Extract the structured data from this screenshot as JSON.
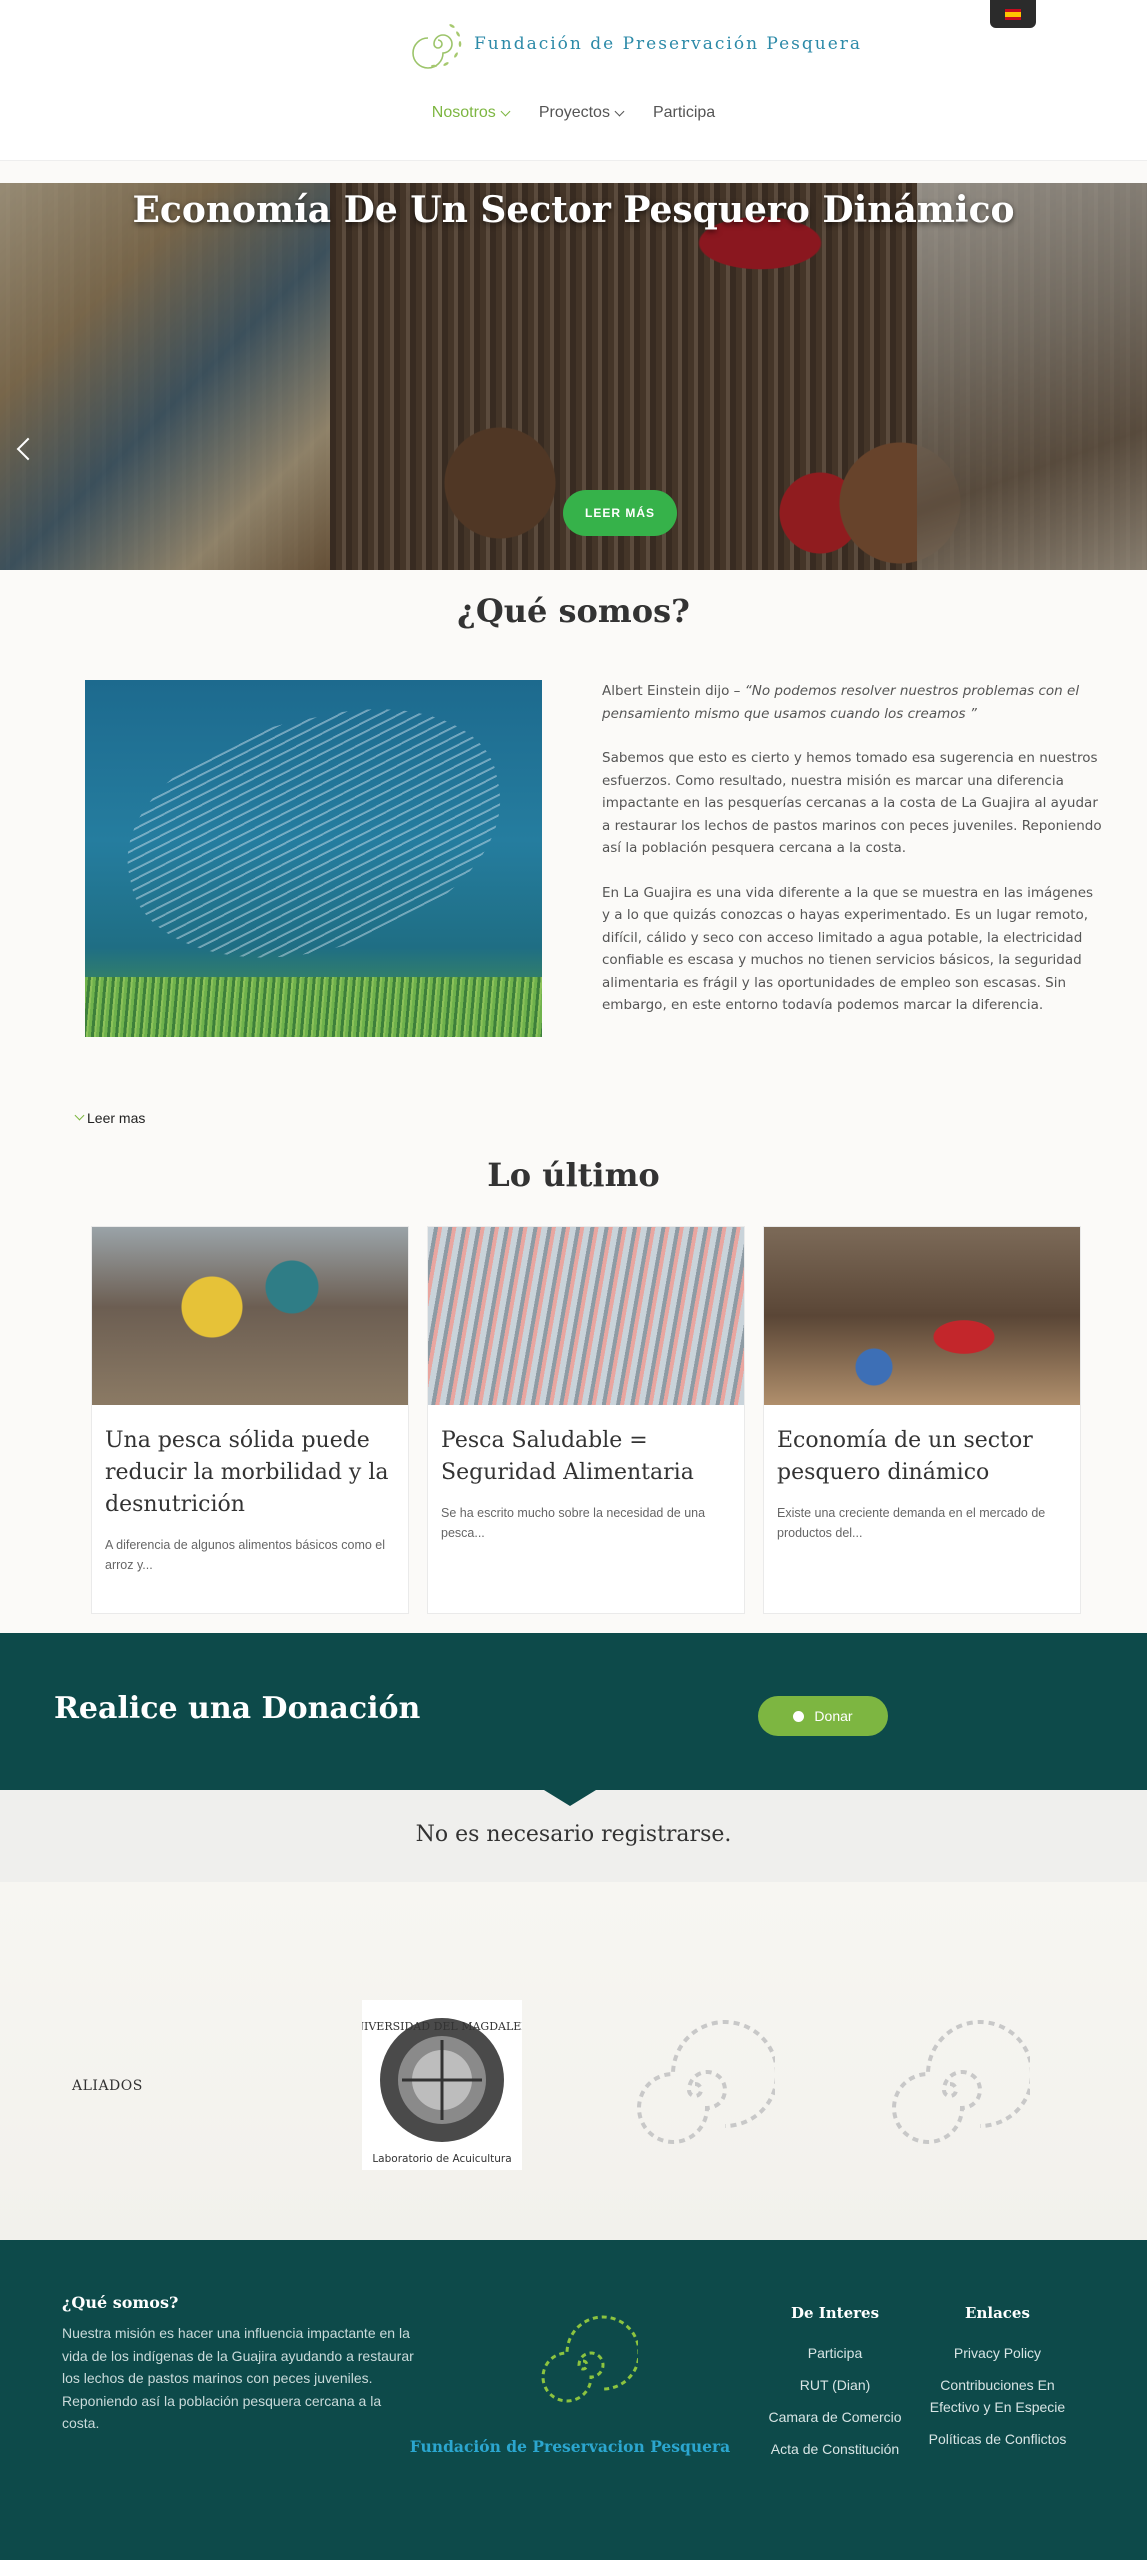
{
  "header": {
    "logo_text": "Fundación de Preservación Pesquera",
    "nav": [
      {
        "label": "Nosotros",
        "active": true
      },
      {
        "label": "Proyectos",
        "active": false
      },
      {
        "label": "Participa",
        "active": false
      }
    ]
  },
  "hero": {
    "title": "Economía De Un Sector Pesquero Dinámico",
    "button": "LEER MÁS"
  },
  "about": {
    "title": "¿Qué somos?",
    "quote_author": "Albert Einstein dijo –",
    "quote": "“No podemos resolver nuestros problemas con el pensamiento mismo que usamos cuando los creamos ”",
    "p1": "Sabemos que esto es cierto y hemos tomado esa sugerencia en nuestros esfuerzos. Como resultado, nuestra misión es marcar una diferencia impactante en las pesquerías cercanas a la costa de La Guajira al ayudar a restaurar los lechos de pastos marinos con peces juveniles. Reponiendo así la población pesquera cercana a la costa.",
    "p2": "En La Guajira es una vida diferente a la que se muestra en las imágenes y a lo que quizás conozcas o hayas experimentado. Es un lugar remoto, difícil, cálido y seco con acceso limitado a agua potable, la electricidad confiable es escasa y muchos no tienen servicios básicos, la seguridad alimentaria es frágil y las oportunidades de empleo son escasas. Sin embargo, en este entorno todavía podemos marcar la diferencia.",
    "read_more": "Leer mas"
  },
  "latest": {
    "title": "Lo último",
    "cards": [
      {
        "title": "Una pesca sólida puede reducir la morbilidad y la desnutrición",
        "excerpt": "A diferencia de algunos alimentos básicos como el arroz y..."
      },
      {
        "title": "Pesca Saludable = Seguridad Alimentaria",
        "excerpt": "Se ha escrito mucho sobre la necesidad de una pesca..."
      },
      {
        "title": "Economía de un sector pesquero dinámico",
        "excerpt": "Existe una creciente demanda en el mercado de productos del..."
      }
    ]
  },
  "donation": {
    "title": "Realice una Donación",
    "button": "Donar",
    "note": "No es necesario registrarse."
  },
  "allies": {
    "label": "ALIADOS",
    "university_name": "UNIVERSIDAD DEL MAGDALENA",
    "university_lab": "Laboratorio de Acuicultura"
  },
  "footer": {
    "about_title": "¿Qué somos?",
    "about_text": "Nuestra misión es hacer una influencia impactante en la vida de los indígenas de la Guajira ayudando a restaurar los lechos de pastos marinos con peces juveniles. Reponiendo así la población pesquera cercana a la costa.",
    "org_name": "Fundación de Preservacion Pesquera",
    "interest_title": "De Interes",
    "interest_links": [
      "Participa",
      "RUT (Dian)",
      "Camara de Comercio",
      "Acta de Constitución"
    ],
    "links_title": "Enlaces",
    "links": [
      "Privacy Policy",
      "Contribuciones En Efectivo y En Especie",
      "Políticas de Conflictos"
    ]
  },
  "colors": {
    "accent_green": "#7db641",
    "button_green": "#36b24a",
    "dark_teal": "#0d4a4a",
    "brand_blue": "#2c8aa8"
  },
  "icons": [
    "spiral-fish-logo-icon",
    "spain-flag-icon",
    "chevron-down-icon",
    "chevron-left-icon",
    "donate-dot-icon"
  ]
}
